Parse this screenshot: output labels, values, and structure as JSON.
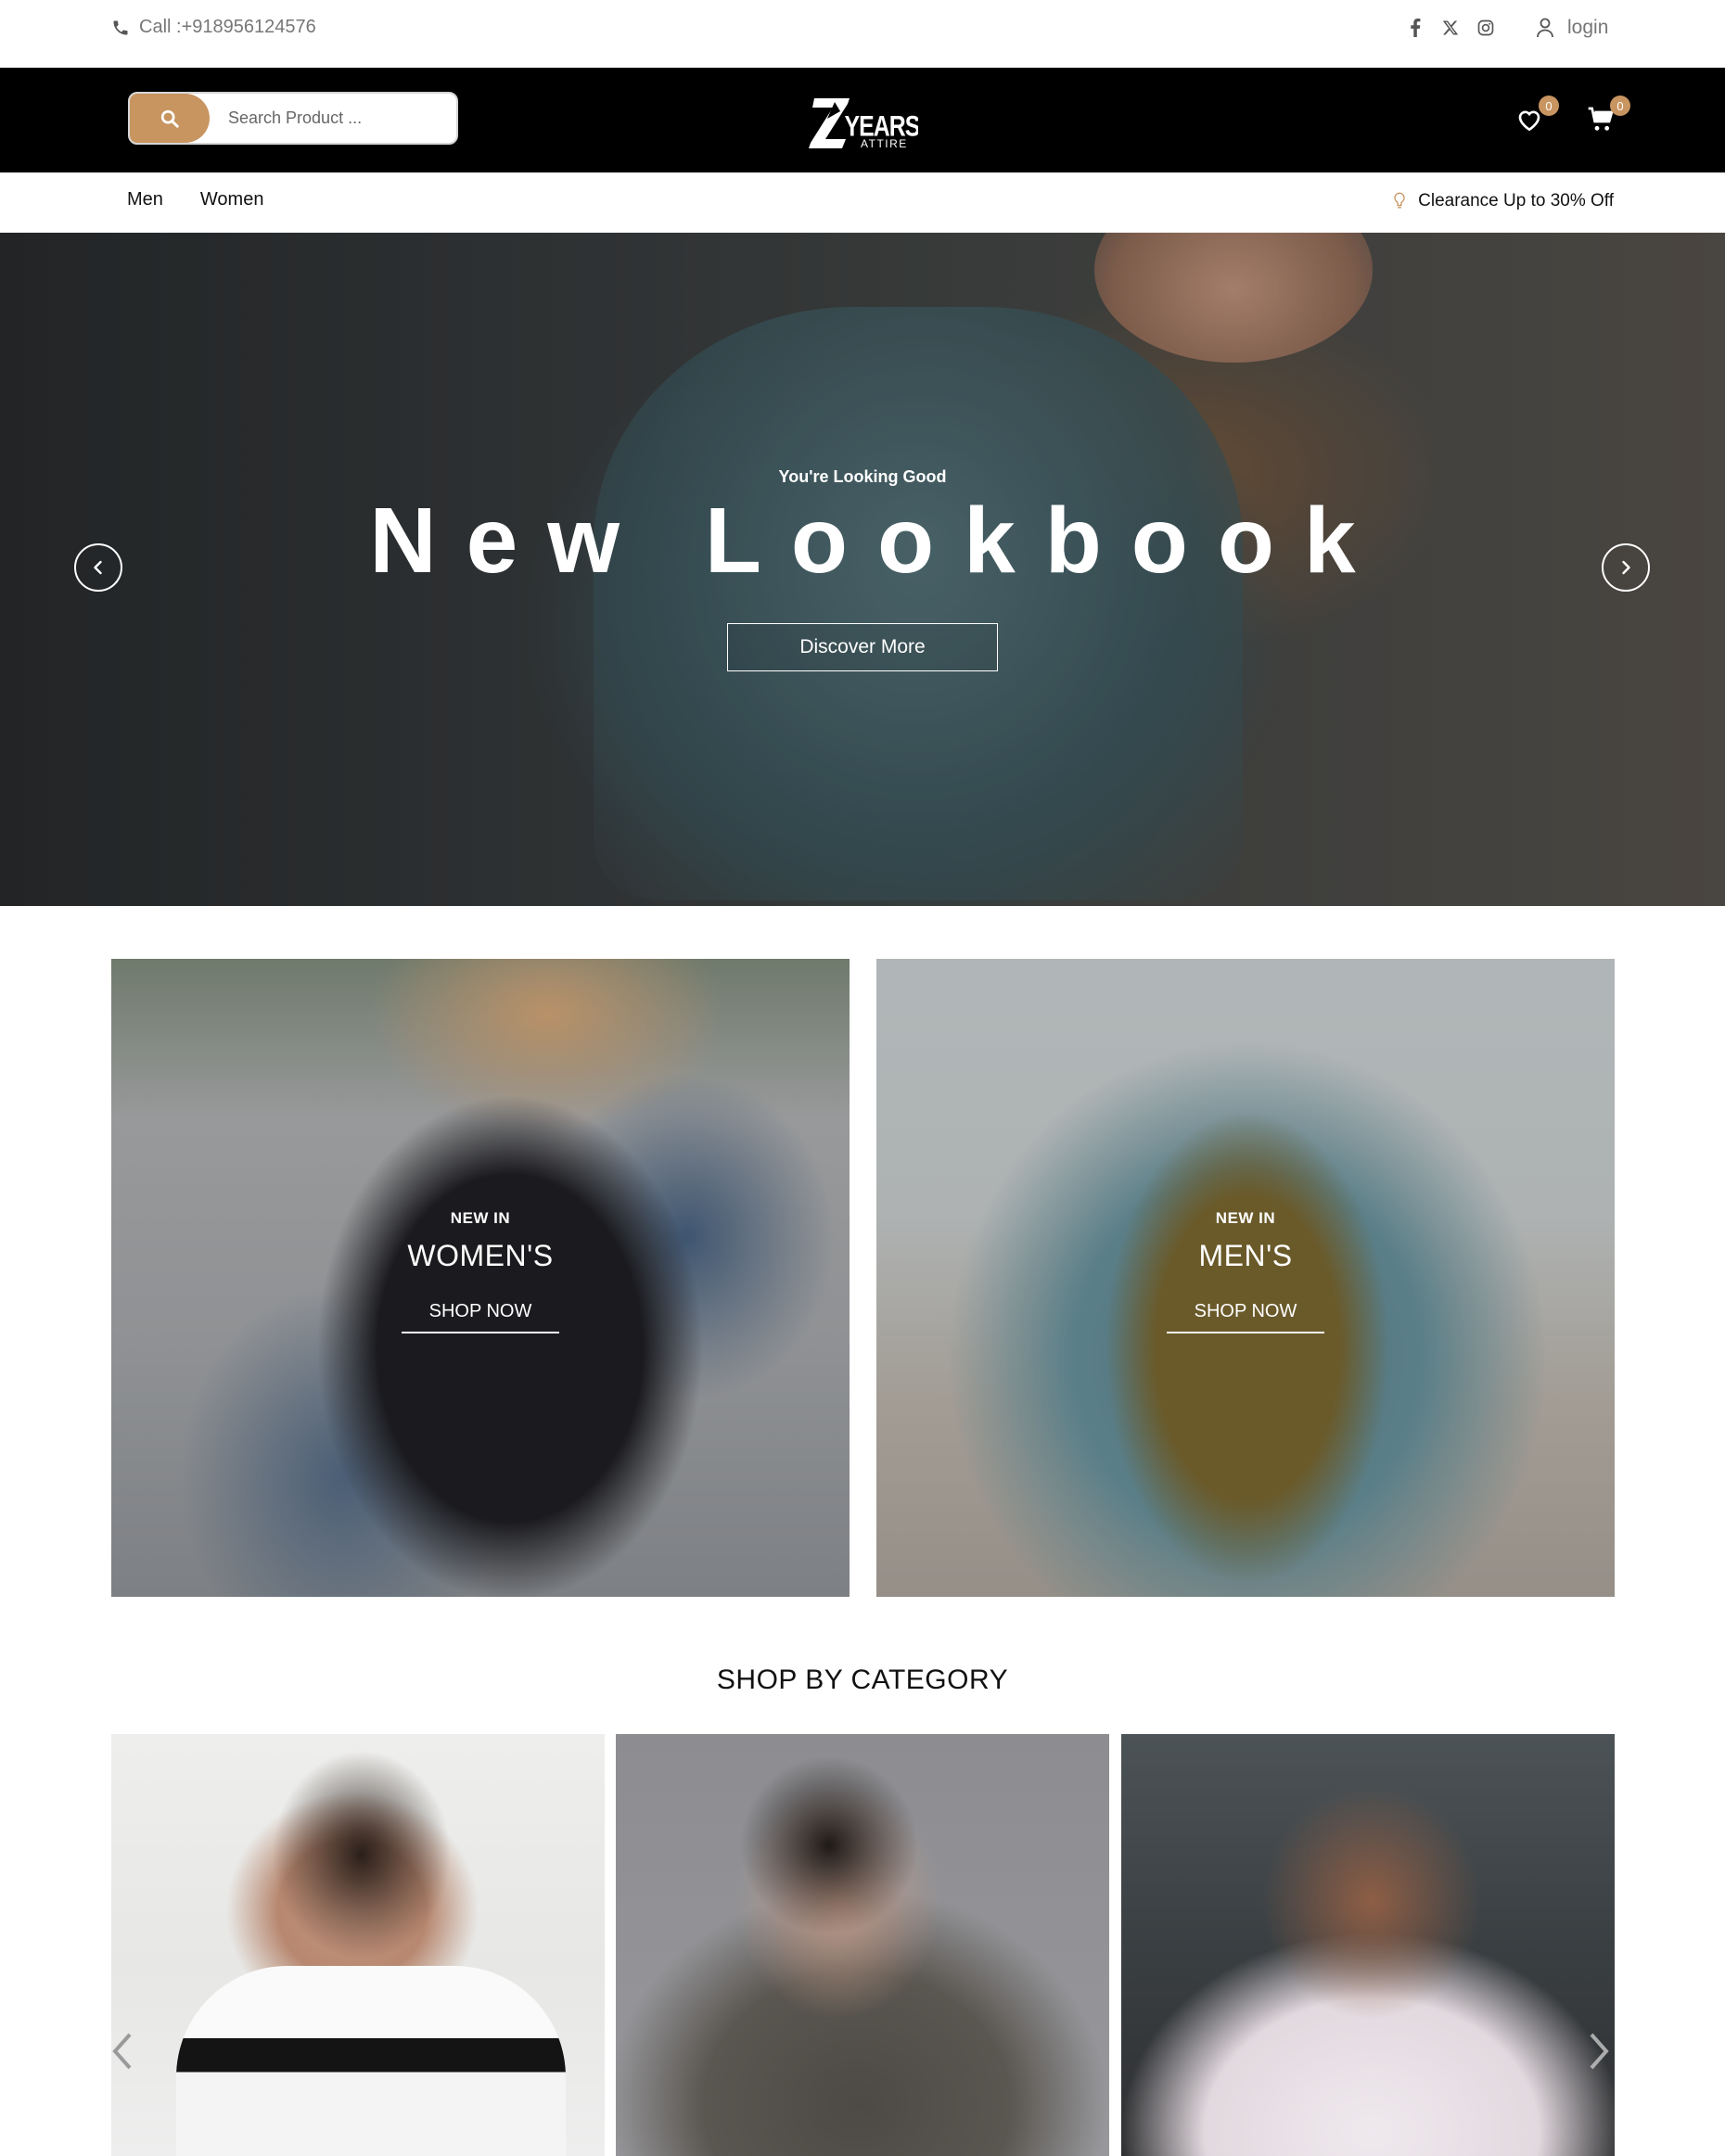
{
  "topbar": {
    "call_text": "Call :+918956124576",
    "socials": [
      "facebook-icon",
      "x-twitter-icon",
      "instagram-icon"
    ],
    "login_label": "login"
  },
  "header": {
    "search_placeholder": "Search Product ...",
    "logo": "Zyears Attire",
    "wishlist_count": "0",
    "cart_count": "0"
  },
  "nav": {
    "items": [
      "Men",
      "Women"
    ],
    "promo_text": "Clearance Up to 30% Off"
  },
  "hero": {
    "eyebrow": "You're Looking Good",
    "headline": "New Lookbook",
    "cta": "Discover More"
  },
  "promos": [
    {
      "small": "NEW IN",
      "big": "WOMEN'S",
      "cta": "SHOP NOW"
    },
    {
      "small": "NEW IN",
      "big": "MEN'S",
      "cta": "SHOP NOW"
    }
  ],
  "category": {
    "title": "SHOP BY CATEGORY"
  },
  "colors": {
    "accent": "#c89460",
    "header_bg": "#000000"
  }
}
